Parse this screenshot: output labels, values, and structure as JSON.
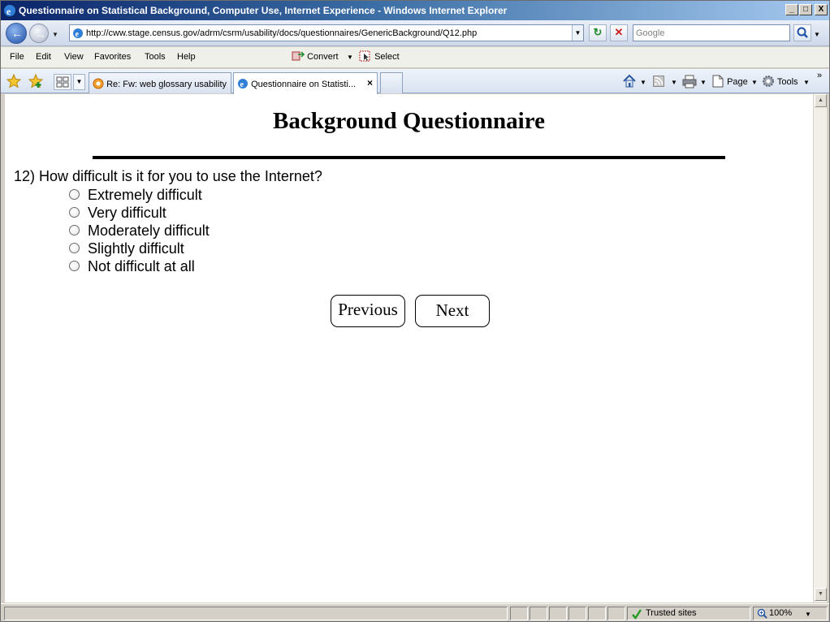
{
  "window": {
    "title": "Questionnaire on Statistical Background, Computer Use, Internet Experience - Windows Internet Explorer",
    "controls": [
      "_",
      "□",
      "X"
    ]
  },
  "nav": {
    "url": "http://cww.stage.census.gov/adrm/csrm/usability/docs/questionnaires/GenericBackground/Q12.php",
    "search_placeholder": "Google"
  },
  "menubar": {
    "items": [
      "File",
      "Edit",
      "View",
      "Favorites",
      "Tools",
      "Help"
    ],
    "convert_label": "Convert",
    "select_label": "Select"
  },
  "tabs": [
    {
      "label": "Re: Fw: web glossary usability"
    },
    {
      "label": "Questionnaire on Statisti...",
      "close": "×"
    }
  ],
  "command_bar": {
    "page_label": "Page",
    "tools_label": "Tools"
  },
  "page": {
    "heading": "Background Questionnaire",
    "question": "12) How difficult is it for you to use the Internet?",
    "options": [
      "Extremely difficult",
      "Very difficult",
      "Moderately difficult",
      "Slightly difficult",
      "Not difficult at all"
    ],
    "previous_label": "Previous",
    "next_label": "Next"
  },
  "status": {
    "zone": "Trusted sites",
    "zoom": "100%"
  },
  "colors": {
    "title_bar": "#0a246a",
    "chrome": "#d4d0c8"
  }
}
